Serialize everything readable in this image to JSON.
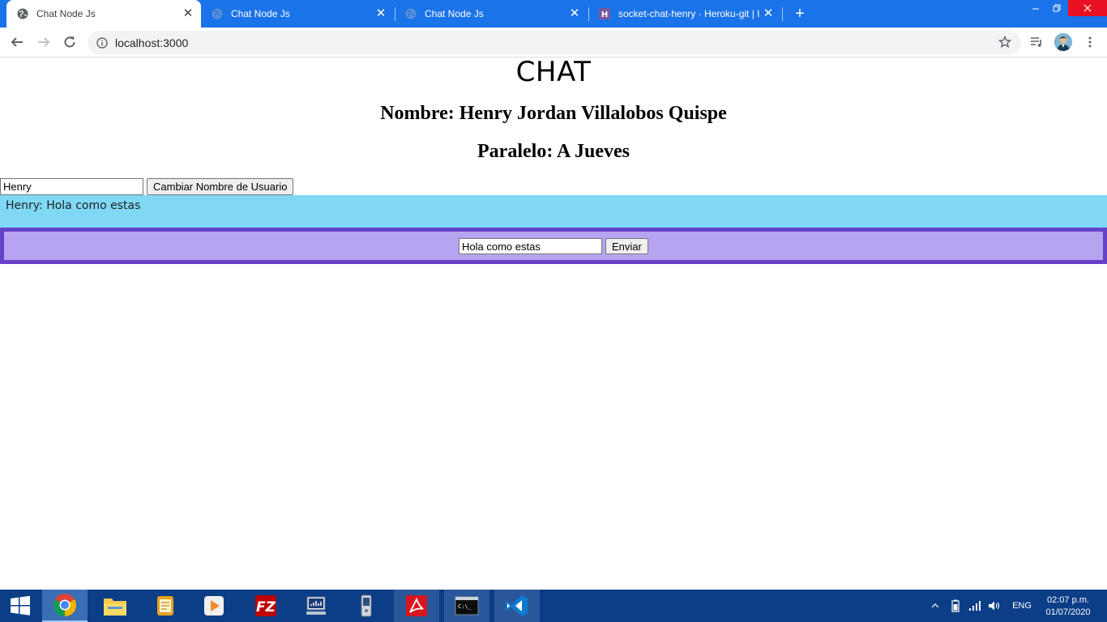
{
  "browser": {
    "tabs": [
      {
        "title": "Chat Node Js",
        "active": true
      },
      {
        "title": "Chat Node Js",
        "active": false
      },
      {
        "title": "Chat Node Js",
        "active": false
      },
      {
        "title": "socket-chat-henry · Heroku-git | I",
        "active": false
      }
    ],
    "url": "localhost:3000"
  },
  "page": {
    "heading": "CHAT",
    "name_line": "Nombre: Henry Jordan Villalobos Quispe",
    "paralelo_line": "Paralelo: A Jueves",
    "username_value": "Henry",
    "change_name_button": "Cambiar Nombre de Usuario",
    "messages": [
      "Henry: Hola como estas"
    ],
    "message_input_value": "Hola como estas",
    "send_button": "Enviar"
  },
  "taskbar": {
    "apps": [
      "start",
      "chrome",
      "file-explorer",
      "notes",
      "media-player",
      "filezilla",
      "network-app",
      "device-app",
      "acrobat",
      "command-prompt",
      "vscode"
    ],
    "language": "ENG",
    "time": "02:07 p.m.",
    "date": "01/07/2020"
  },
  "colors": {
    "chrome_blue": "#1a73e8",
    "messages_bg": "#80d8f5",
    "sendbar_bg": "#b7a4f1",
    "sendbar_border": "#6541c7",
    "taskbar": "#0b3e86"
  }
}
